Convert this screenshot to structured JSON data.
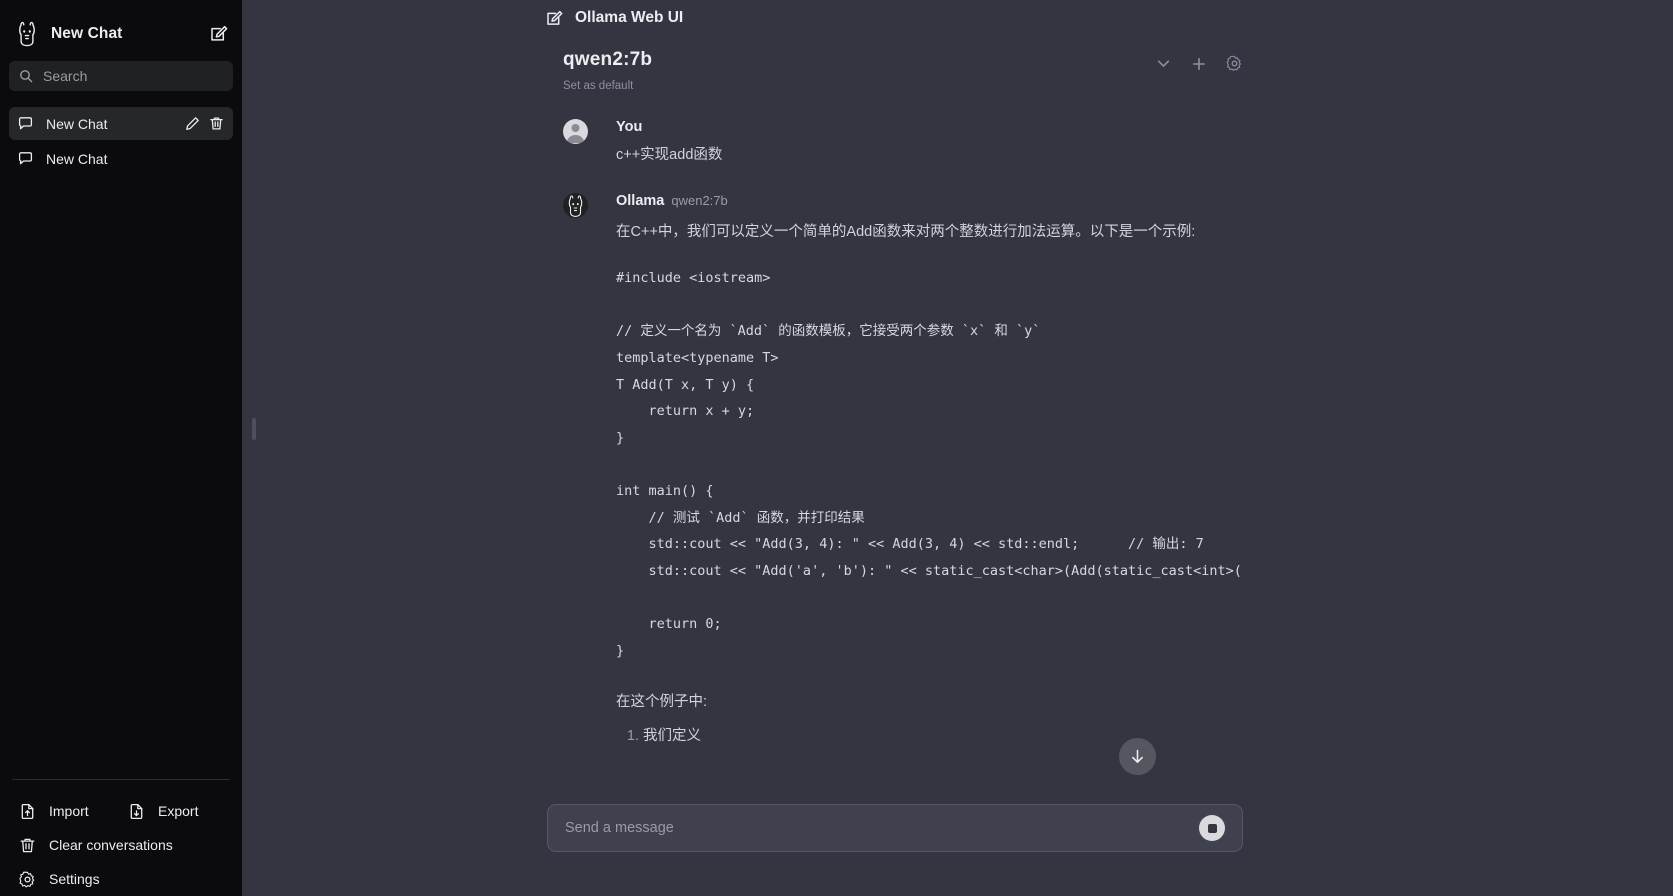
{
  "sidebar": {
    "logo_icon": "llama-icon",
    "title": "New Chat",
    "new_chat_icon": "edit-square-icon",
    "search": {
      "placeholder": "Search",
      "icon": "search-icon"
    },
    "chats": [
      {
        "label": "New Chat",
        "icon": "chat-bubble-icon",
        "active": true,
        "edit_icon": "pencil-icon",
        "delete_icon": "trash-icon"
      },
      {
        "label": "New Chat",
        "icon": "chat-bubble-icon",
        "active": false
      }
    ],
    "footer": {
      "import": {
        "label": "Import",
        "icon": "file-upload-icon"
      },
      "export": {
        "label": "Export",
        "icon": "file-download-icon"
      },
      "clear": {
        "label": "Clear conversations",
        "icon": "trash-icon"
      },
      "settings": {
        "label": "Settings",
        "icon": "gear-icon"
      }
    }
  },
  "header": {
    "icon": "edit-square-icon",
    "title": "Ollama Web UI"
  },
  "model": {
    "name": "qwen2:7b",
    "set_default_label": "Set as default",
    "chevron_icon": "chevron-down-icon",
    "add_icon": "plus-icon",
    "settings_icon": "gear-icon"
  },
  "messages": [
    {
      "role": "You",
      "avatar": "user-avatar",
      "text": "c++实现add函数"
    },
    {
      "role": "Ollama",
      "model_tag": "qwen2:7b",
      "avatar": "llama-avatar",
      "intro": "在C++中，我们可以定义一个简单的Add函数来对两个整数进行加法运算。以下是一个示例:",
      "code": "#include <iostream>\n\n// 定义一个名为 `Add` 的函数模板，它接受两个参数 `x` 和 `y`\ntemplate<typename T>\nT Add(T x, T y) {\n    return x + y;\n}\n\nint main() {\n    // 测试 `Add` 函数，并打印结果\n    std::cout << \"Add(3, 4): \" << Add(3, 4) << std::endl;      // 输出: 7\n    std::cout << \"Add('a', 'b'): \" << static_cast<char>(Add(static_cast<int>('\n\n    return 0;\n}",
      "outro": "在这个例子中:",
      "list": [
        "我们定义"
      ]
    }
  ],
  "scroll_button": {
    "icon": "arrow-down-icon"
  },
  "composer": {
    "placeholder": "Send a message",
    "stop_button_icon": "stop-square-icon"
  },
  "colors": {
    "sidebar_bg": "#0b0b0d",
    "main_bg": "#343541",
    "active_item": "#26272b",
    "text_primary": "#ececf1",
    "text_muted": "#9b9ba4",
    "composer_bg": "#40414f"
  }
}
